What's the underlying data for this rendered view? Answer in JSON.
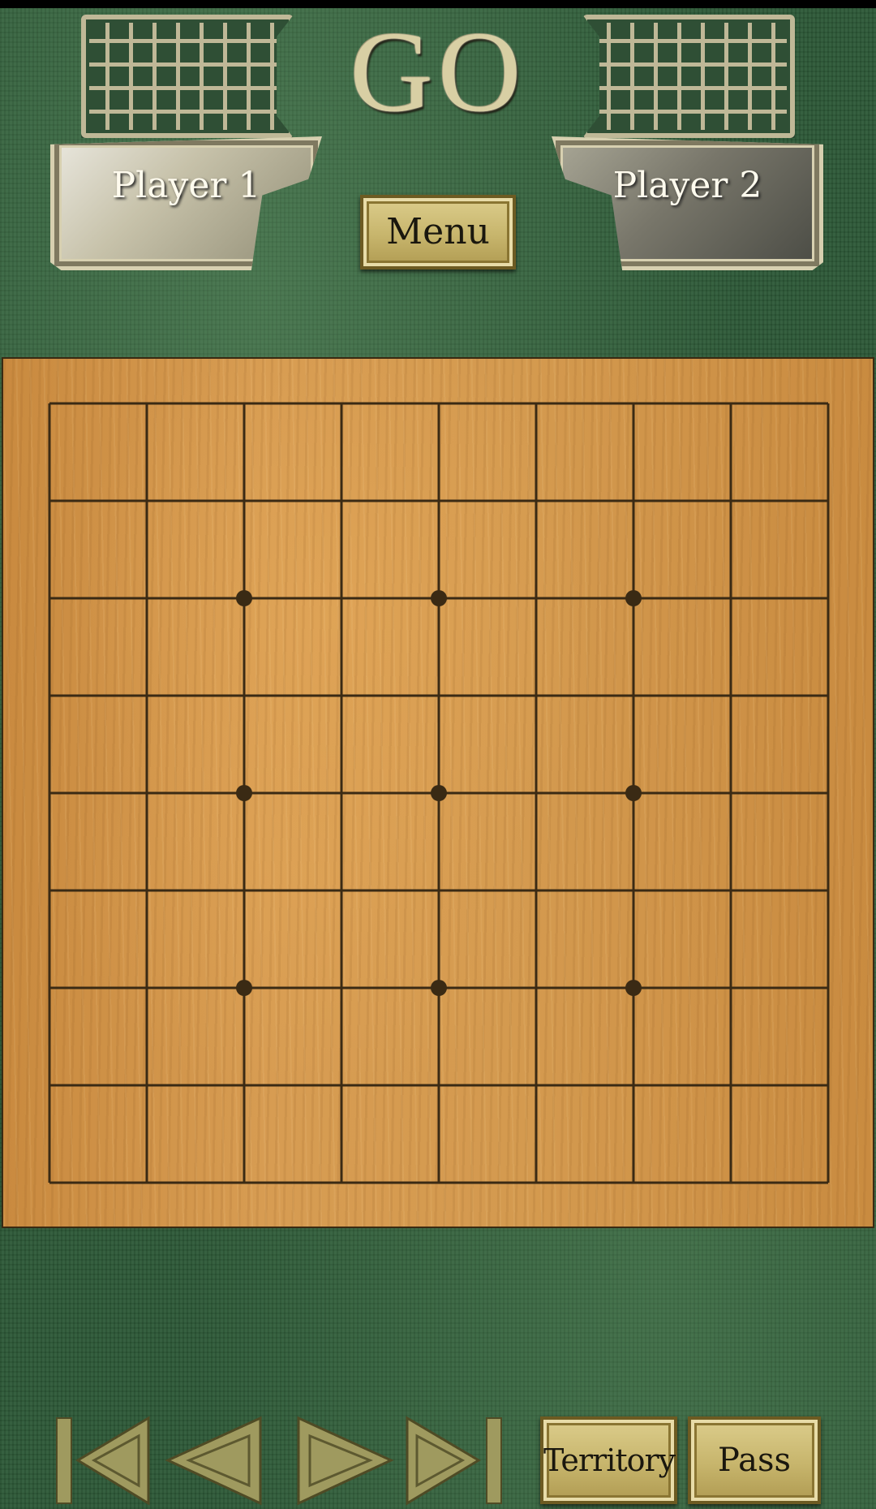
{
  "header": {
    "title": "GO",
    "player1": "Player 1",
    "player2": "Player 2",
    "menu_label": "Menu"
  },
  "board": {
    "size": 9,
    "star_points": [
      [
        2,
        2
      ],
      [
        2,
        4
      ],
      [
        2,
        6
      ],
      [
        4,
        2
      ],
      [
        4,
        4
      ],
      [
        4,
        6
      ],
      [
        6,
        2
      ],
      [
        6,
        4
      ],
      [
        6,
        6
      ]
    ]
  },
  "controls": {
    "first_icon": "skip-first-icon",
    "prev_icon": "previous-icon",
    "next_icon": "next-icon",
    "last_icon": "skip-last-icon",
    "territory_label": "Territory",
    "pass_label": "Pass"
  },
  "colors": {
    "felt": "#2e5a38",
    "board_wood": "#d49a4f",
    "grid_line": "#3a2a14",
    "gold_button": "#c7b56c",
    "arrow": "#9f9a5f"
  }
}
